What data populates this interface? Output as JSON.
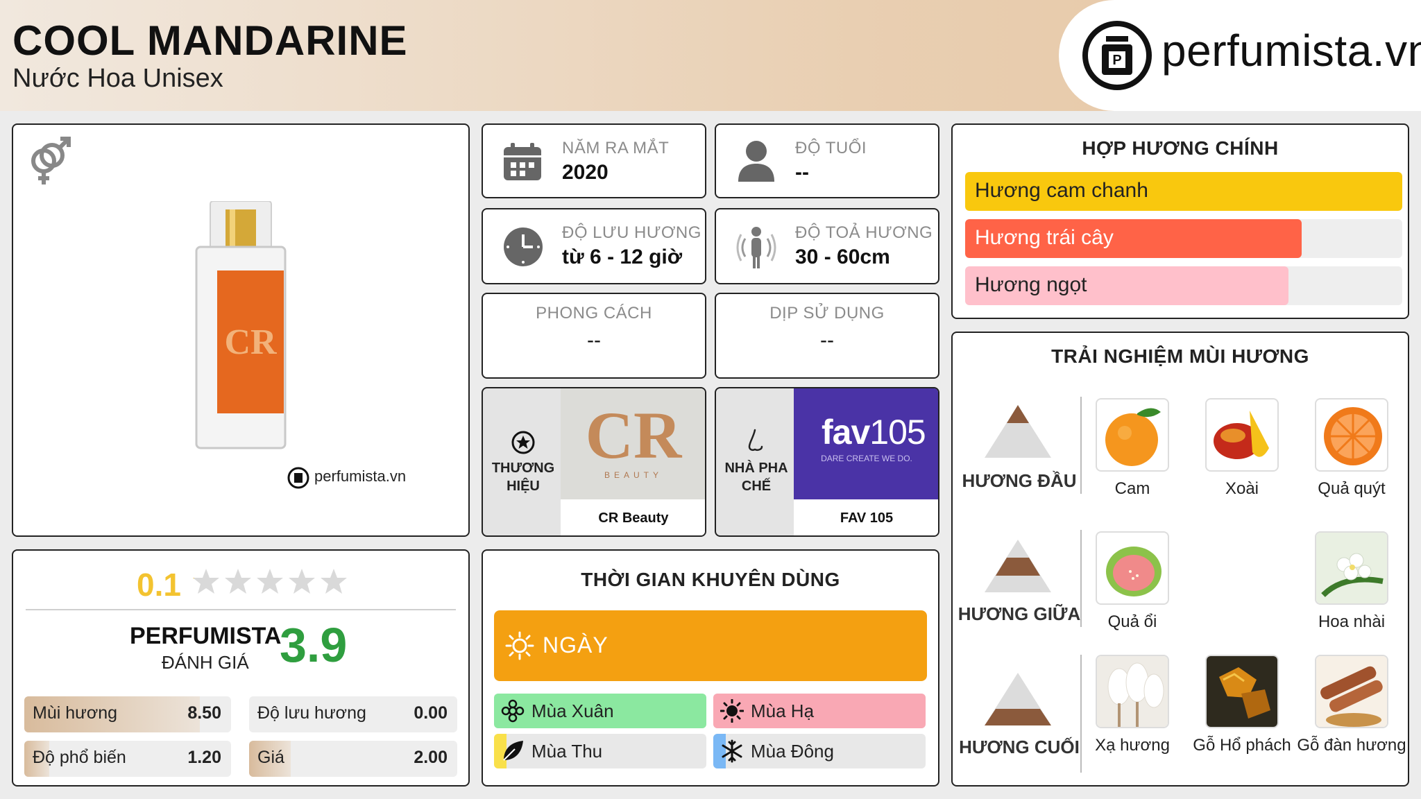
{
  "header": {
    "title": "COOL MANDARINE",
    "subtitle": "Nước Hoa Unisex",
    "brand_logo_text": "perfumista.vn"
  },
  "product": {
    "gender_icon": "unisex-symbol-icon",
    "watermark": "perfumista.vn",
    "bottle_label": "CR"
  },
  "info": {
    "launch_year": {
      "label": "NĂM RA MẮT",
      "value": "2020",
      "icon": "calendar-icon"
    },
    "age": {
      "label": "ĐỘ TUỔI",
      "value": "--",
      "icon": "person-icon"
    },
    "longevity": {
      "label": "ĐỘ LƯU HƯƠNG",
      "value": "từ 6 - 12 giờ",
      "icon": "clock-icon"
    },
    "sillage": {
      "label": "ĐỘ TOẢ HƯƠNG",
      "value": "30 - 60cm",
      "icon": "sillage-icon"
    },
    "style": {
      "label": "PHONG CÁCH",
      "value": "--"
    },
    "occasion": {
      "label": "DỊP SỬ DỤNG",
      "value": "--"
    }
  },
  "brand": {
    "label": "THƯƠNG HIỆU",
    "name": "CR Beauty",
    "logo_text": "CR",
    "logo_sub": "BEAUTY",
    "icon": "star-circle-icon"
  },
  "perfumer": {
    "label": "NHÀ PHA CHẾ",
    "name": "FAV 105",
    "logo_main_a": "fav",
    "logo_main_b": "105",
    "logo_tagline": "DARE CREATE WE DO.",
    "icon": "nose-icon"
  },
  "accords": {
    "title": "HỢP HƯƠNG CHÍNH",
    "items": [
      {
        "label": "Hương cam chanh",
        "level": 1.0,
        "color": "#f9c80e"
      },
      {
        "label": "Hương trái cây",
        "level": 0.77,
        "color": "#ff6347"
      },
      {
        "label": "Hương ngọt",
        "level": 0.74,
        "color": "#ffc0cb"
      }
    ]
  },
  "experience": {
    "title": "TRẢI NGHIỆM MÙI HƯƠNG",
    "top": {
      "label": "HƯƠNG ĐẦU",
      "items": [
        "Cam",
        "Xoài",
        "Quả quýt"
      ]
    },
    "middle": {
      "label": "HƯƠNG GIỮA",
      "items": [
        "Quả ổi",
        "Hoa nhài"
      ]
    },
    "base": {
      "label": "HƯƠNG CUỐI",
      "items": [
        "Xạ hương",
        "Gỗ Hổ phách",
        "Gỗ đàn hương"
      ]
    }
  },
  "rating": {
    "user_score": "0.1",
    "stars_filled": 0.02,
    "perfumista_label": "PERFUMISTA",
    "perfumista_sub": "ĐÁNH GIÁ",
    "perfumista_score": "3.9",
    "scores": [
      {
        "label": "Mùi hương",
        "value": "8.50",
        "level": 0.85
      },
      {
        "label": "Độ lưu hương",
        "value": "0.00",
        "level": 0.0
      },
      {
        "label": "Độ phổ biến",
        "value": "1.20",
        "level": 0.12
      },
      {
        "label": "Giá",
        "value": "2.00",
        "level": 0.2
      }
    ]
  },
  "time": {
    "title": "THỜI GIAN KHUYÊN DÙNG",
    "day_label": "NGÀY",
    "day_level": 1.0,
    "seasons": [
      {
        "label": "Mùa Xuân",
        "level": 1.0,
        "color": "#8be8a0",
        "icon": "flower-icon"
      },
      {
        "label": "Mùa Hạ",
        "level": 1.0,
        "color": "#f9a8b4",
        "icon": "sun-icon"
      },
      {
        "label": "Mùa Thu",
        "level": 0.06,
        "color": "#f9e04a",
        "icon": "leaf-icon"
      },
      {
        "label": "Mùa Đông",
        "level": 0.06,
        "color": "#7ab8f5",
        "icon": "snowflake-icon"
      }
    ]
  },
  "colors": {
    "accent_orange": "#f4a011",
    "score_yellow": "#f3c330",
    "score_green": "#2f9e3f",
    "score_bar": "#d8bb9c"
  }
}
